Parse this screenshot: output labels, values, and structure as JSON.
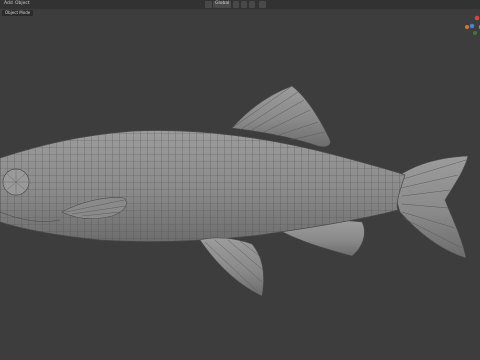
{
  "header": {
    "menu": [
      "Add",
      "Object"
    ],
    "mode": "Object Mode",
    "transform_orientation": "Global",
    "icons": [
      "orientation-icon",
      "pivot-icon",
      "snap-icon",
      "snap-toggle-icon",
      "proportional-edit-icon"
    ]
  },
  "viewport": {
    "object": "fish-mesh",
    "display": "wireframe-on-shaded",
    "background_color": "#3d3d3d",
    "mesh_color": "#8e8e8e",
    "wire_color": "#505050"
  },
  "gizmo": {
    "axes": [
      "x",
      "y",
      "z"
    ],
    "colors": {
      "x": "#d64545",
      "y": "#6fa63a",
      "z": "#4a7fd6"
    }
  }
}
